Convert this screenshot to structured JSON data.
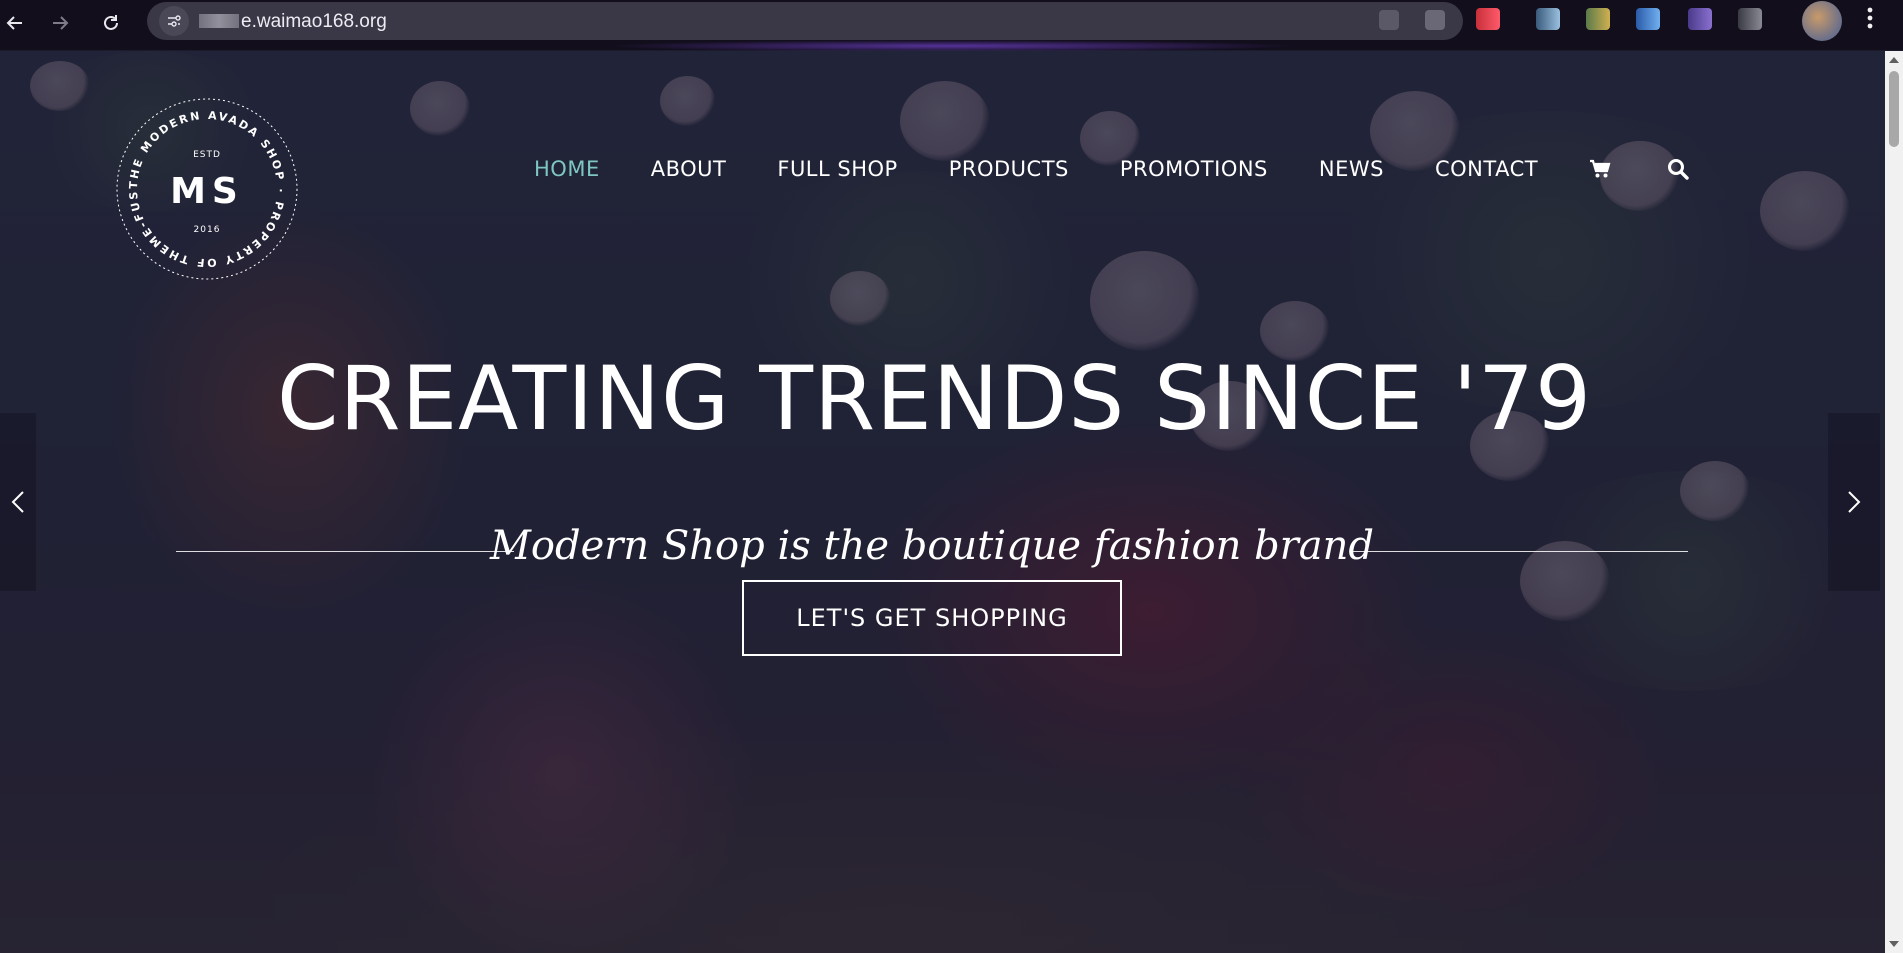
{
  "browser": {
    "url_visible": "e.waimao168.org",
    "back_icon": "arrow-left-icon",
    "forward_icon": "arrow-right-icon",
    "reload_icon": "reload-icon",
    "site_settings_icon": "tune-icon",
    "menu_icon": "vertical-dots-icon"
  },
  "logo": {
    "ring_text": "THE MODERN AVADA SHOP · PROPERTY OF THEME-FUSION ·",
    "estd": "ESTD",
    "initials": "MS",
    "year": "2016"
  },
  "nav": {
    "items": [
      {
        "label": "HOME",
        "active": true
      },
      {
        "label": "ABOUT",
        "active": false
      },
      {
        "label": "FULL SHOP",
        "active": false
      },
      {
        "label": "PRODUCTS",
        "active": false
      },
      {
        "label": "PROMOTIONS",
        "active": false
      },
      {
        "label": "NEWS",
        "active": false
      },
      {
        "label": "CONTACT",
        "active": false
      }
    ],
    "cart_icon": "shopping-cart-icon",
    "search_icon": "search-icon"
  },
  "hero": {
    "headline": "CREATING TRENDS SINCE '79",
    "subline": "Modern Shop is the boutique fashion brand",
    "cta_label": "LET'S GET SHOPPING",
    "prev_icon": "chevron-left-icon",
    "next_icon": "chevron-right-icon"
  },
  "colors": {
    "accent_active_nav": "#7ec7c0",
    "text": "#ffffff",
    "overlay": "#1c1a34"
  }
}
